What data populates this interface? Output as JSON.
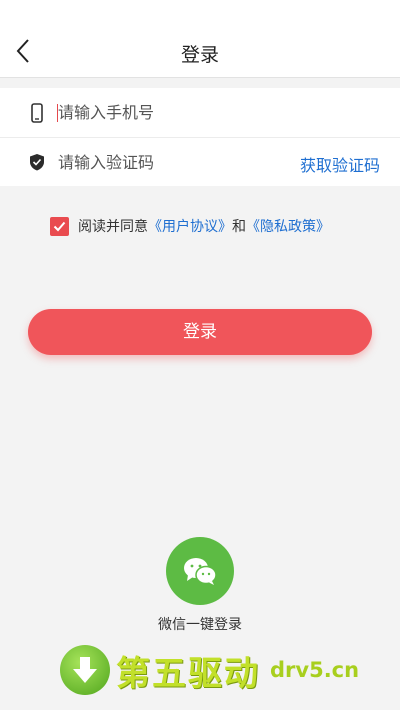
{
  "header": {
    "title": "登录",
    "back_icon": "chevron-left-icon"
  },
  "form": {
    "phone": {
      "icon": "phone-icon",
      "placeholder": "请输入手机号",
      "value": ""
    },
    "code": {
      "icon": "shield-icon",
      "placeholder": "请输入验证码",
      "value": "",
      "get_code_label": "获取验证码"
    }
  },
  "agreement": {
    "checked": true,
    "prefix": "阅读并同意",
    "user_agreement": "《用户协议》",
    "and": "和",
    "privacy_policy": "《隐私政策》"
  },
  "login_button": {
    "label": "登录"
  },
  "wechat": {
    "icon": "wechat-icon",
    "label": "微信一键登录"
  },
  "watermark": {
    "brand": "第五驱动",
    "domain": "drv5.cn"
  },
  "colors": {
    "accent": "#f0555a",
    "link": "#1f6fd1",
    "wechat": "#5dbb44",
    "background": "#f3f3f3"
  }
}
